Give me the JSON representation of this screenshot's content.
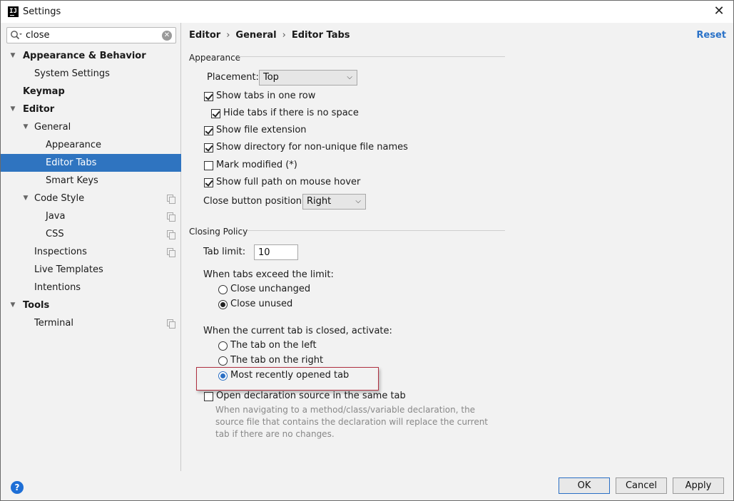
{
  "window": {
    "title": "Settings",
    "app_icon_text": "IJ"
  },
  "sidebar": {
    "search": {
      "value": "close"
    },
    "items": [
      {
        "label": "Appearance & Behavior"
      },
      {
        "label": "System Settings"
      },
      {
        "label": "Keymap"
      },
      {
        "label": "Editor"
      },
      {
        "label": "General"
      },
      {
        "label": "Appearance"
      },
      {
        "label": "Editor Tabs"
      },
      {
        "label": "Smart Keys"
      },
      {
        "label": "Code Style"
      },
      {
        "label": "Java"
      },
      {
        "label": "CSS"
      },
      {
        "label": "Inspections"
      },
      {
        "label": "Live Templates"
      },
      {
        "label": "Intentions"
      },
      {
        "label": "Tools"
      },
      {
        "label": "Terminal"
      }
    ],
    "selected_color": "#2f74c0"
  },
  "breadcrumb": {
    "items": [
      "Editor",
      "General",
      "Editor Tabs"
    ],
    "separator": "›"
  },
  "reset_label": "Reset",
  "appearance": {
    "title": "Appearance",
    "placement_label": "Placement:",
    "placement_value": "Top",
    "show_tabs_one_row": {
      "label": "Show tabs in one row",
      "checked": true
    },
    "hide_tabs_no_space": {
      "label": "Hide tabs if there is no space",
      "checked": true
    },
    "show_file_extension": {
      "label": "Show file extension",
      "checked": true
    },
    "show_directory": {
      "label": "Show directory for non-unique file names",
      "checked": true
    },
    "mark_modified": {
      "label": "Mark modified (*)",
      "checked": false
    },
    "show_full_path": {
      "label": "Show full path on mouse hover",
      "checked": true
    },
    "close_button_label": "Close button position:",
    "close_button_value": "Right"
  },
  "closing_policy": {
    "title": "Closing Policy",
    "tab_limit_label": "Tab limit:",
    "tab_limit_value": "10",
    "exceed_label": "When tabs exceed the limit:",
    "close_unchanged": "Close unchanged",
    "close_unused": "Close unused",
    "activate_label": "When the current tab is closed, activate:",
    "tab_left": "The tab on the left",
    "tab_right": "The tab on the right",
    "most_recent": "Most recently opened tab",
    "open_declaration": {
      "label": "Open declaration source in the same tab",
      "checked": false
    },
    "description": "When navigating to a method/class/variable declaration, the source file that contains the declaration will replace the current tab if there are no changes."
  },
  "buttons": {
    "ok": "OK",
    "cancel": "Cancel",
    "apply": "Apply",
    "help": "?"
  },
  "highlight_color": "#b03040"
}
